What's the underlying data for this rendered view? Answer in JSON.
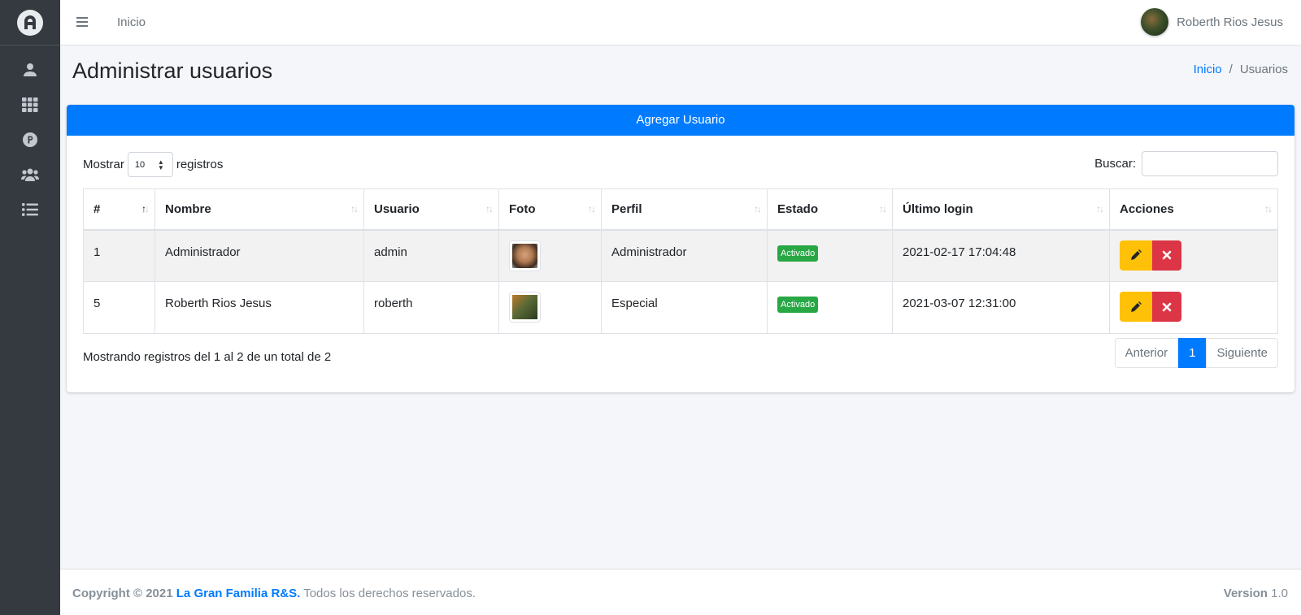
{
  "topbar": {
    "home_link": "Inicio",
    "user_name": "Roberth Rios Jesus"
  },
  "sidebar": {
    "items": [
      {
        "icon": "user-icon"
      },
      {
        "icon": "grid-icon"
      },
      {
        "icon": "p-circle-icon"
      },
      {
        "icon": "users-icon"
      },
      {
        "icon": "list-icon"
      }
    ]
  },
  "page": {
    "title": "Administrar usuarios",
    "breadcrumb": {
      "home": "Inicio",
      "separator": "/",
      "current": "Usuarios"
    }
  },
  "card": {
    "add_button": "Agregar Usuario",
    "show_label": "Mostrar",
    "show_value": "10",
    "records_label": "registros",
    "search_label": "Buscar:",
    "search_value": "",
    "columns": [
      "#",
      "Nombre",
      "Usuario",
      "Foto",
      "Perfil",
      "Estado",
      "Último login",
      "Acciones"
    ],
    "rows": [
      {
        "id": "1",
        "nombre": "Administrador",
        "usuario": "admin",
        "perfil": "Administrador",
        "estado": "Activado",
        "ultimo_login": "2021-02-17 17:04:48"
      },
      {
        "id": "5",
        "nombre": "Roberth Rios Jesus",
        "usuario": "roberth",
        "perfil": "Especial",
        "estado": "Activado",
        "ultimo_login": "2021-03-07 12:31:00"
      }
    ],
    "info": "Mostrando registros del 1 al 2 de un total de 2",
    "pagination": {
      "prev": "Anterior",
      "current": "1",
      "next": "Siguiente"
    }
  },
  "footer": {
    "copyright": "Copyright © 2021",
    "brand": "La Gran Familia R&S.",
    "rights": "Todos los derechos reservados.",
    "version_label": "Version",
    "version_value": "1.0"
  },
  "colors": {
    "primary": "#007bff",
    "sidebar": "#343a40",
    "success": "#28a745",
    "warning": "#ffc107",
    "danger": "#dc3545"
  }
}
